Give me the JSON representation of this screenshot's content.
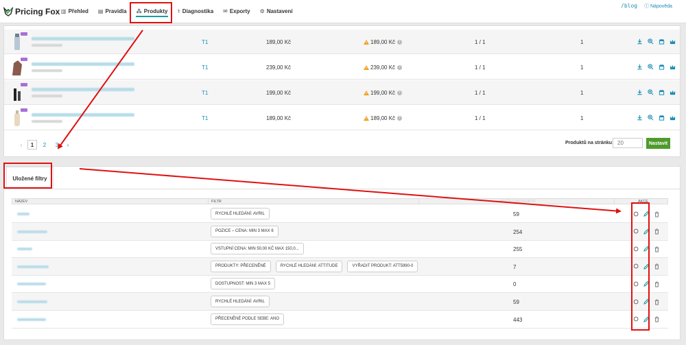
{
  "app": {
    "brand": "Pricing Fox"
  },
  "nav": {
    "items": [
      {
        "label": "Přehled",
        "icon": "bar-chart-icon"
      },
      {
        "label": "Pravidla",
        "icon": "rules-icon"
      },
      {
        "label": "Produkty",
        "icon": "products-icon",
        "active": true
      },
      {
        "label": "Diagnostika",
        "icon": "stethoscope-icon"
      },
      {
        "label": "Exporty",
        "icon": "envelope-icon"
      },
      {
        "label": "Nastavení",
        "icon": "gear-icon"
      }
    ],
    "blog": "/blog",
    "help": "Nápověda"
  },
  "products": {
    "rows": [
      {
        "type": "T1",
        "price": "189,00 Kč",
        "my_price": "189,00 Kč",
        "ratio": "1 / 1",
        "count": "1"
      },
      {
        "type": "T1",
        "price": "239,00 Kč",
        "my_price": "239,00 Kč",
        "ratio": "1 / 1",
        "count": "1"
      },
      {
        "type": "T1",
        "price": "199,00 Kč",
        "my_price": "199,00 Kč",
        "ratio": "1 / 1",
        "count": "1"
      },
      {
        "type": "T1",
        "price": "189,00 Kč",
        "my_price": "189,00 Kč",
        "ratio": "1 / 1",
        "count": "1"
      }
    ],
    "pagination": {
      "pages": [
        "1",
        "2",
        "3"
      ],
      "prev": "‹",
      "next": "›"
    },
    "per_page_label": "Produktů na stránku:",
    "per_page_value": "20",
    "set_button": "Nastavit"
  },
  "saved_filters": {
    "tab_label": "Uložené filtry",
    "columns": {
      "name": "Název",
      "filter": "Filtr",
      "count": "Počet produktů",
      "actions": "Akce"
    },
    "rows": [
      {
        "chips": [
          "Rychlé hledání: AVRIL"
        ],
        "count": "59"
      },
      {
        "chips": [
          "Pozice – cena: min 3 max 6"
        ],
        "count": "254"
      },
      {
        "chips": [
          "Vstupní cena: min 50,00 Kč max 150,0..."
        ],
        "count": "255"
      },
      {
        "chips": [
          "Produkty: přeceněné",
          "Rychlé hledání: attitude",
          "Vyřadit produkt: ATT5990-0"
        ],
        "count": "7"
      },
      {
        "chips": [
          "Dostupnost: min 3 max 5"
        ],
        "count": "0"
      },
      {
        "chips": [
          "Rychlé hledání: AVRIL"
        ],
        "count": "59"
      },
      {
        "chips": [
          "Přeceněné podle sebe: Ano"
        ],
        "count": "443"
      }
    ]
  },
  "colors": {
    "accent": "#1a9c9c",
    "link": "#1a8bb3",
    "annotation": "#e01010",
    "button": "#4f9a2c"
  }
}
